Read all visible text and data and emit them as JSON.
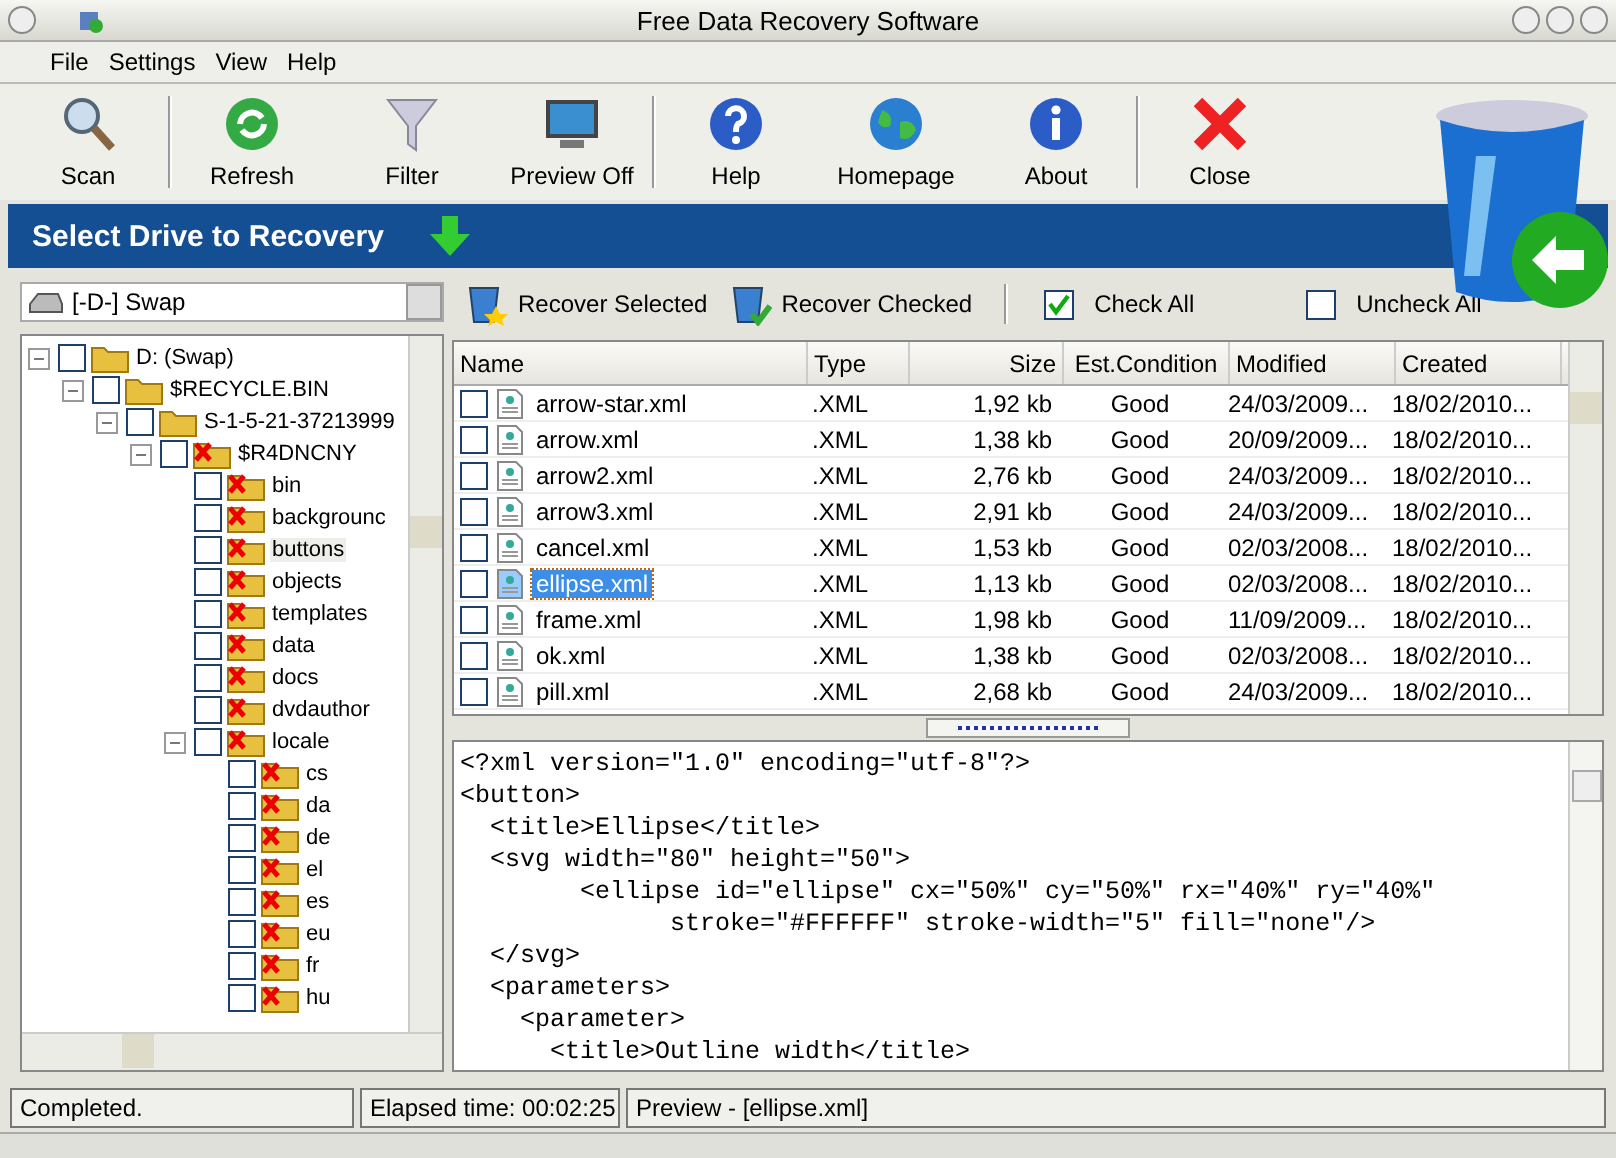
{
  "window": {
    "title": "Free Data Recovery Software"
  },
  "menu": [
    "File",
    "Settings",
    "View",
    "Help"
  ],
  "toolbar": [
    {
      "label": "Scan",
      "kind": "scan"
    },
    {
      "label": "Refresh",
      "kind": "refresh"
    },
    {
      "label": "Filter",
      "kind": "filter"
    },
    {
      "label": "Preview Off",
      "kind": "monitor"
    },
    {
      "label": "Help",
      "kind": "help"
    },
    {
      "label": "Homepage",
      "kind": "globe"
    },
    {
      "label": "About",
      "kind": "info"
    },
    {
      "label": "Close",
      "kind": "close"
    }
  ],
  "banner": {
    "title": "Select Drive to Recovery"
  },
  "drive": {
    "value": "[-D-] Swap"
  },
  "tree": [
    {
      "label": "D: (Swap)",
      "checked": false,
      "deleted": false,
      "selected": false,
      "children": [
        {
          "label": "$RECYCLE.BIN",
          "checked": false,
          "deleted": false,
          "selected": false,
          "children": [
            {
              "label": "S-1-5-21-37213999",
              "checked": false,
              "deleted": false,
              "selected": false,
              "children": [
                {
                  "label": "$R4DNCNY",
                  "checked": false,
                  "deleted": true,
                  "selected": false,
                  "children": [
                    {
                      "label": "bin",
                      "checked": false,
                      "deleted": true,
                      "selected": false
                    },
                    {
                      "label": "backgrounc",
                      "checked": false,
                      "deleted": true,
                      "selected": false
                    },
                    {
                      "label": "buttons",
                      "checked": false,
                      "deleted": true,
                      "selected": true
                    },
                    {
                      "label": "objects",
                      "checked": false,
                      "deleted": true,
                      "selected": false
                    },
                    {
                      "label": "templates",
                      "checked": false,
                      "deleted": true,
                      "selected": false
                    },
                    {
                      "label": "data",
                      "checked": false,
                      "deleted": true,
                      "selected": false
                    },
                    {
                      "label": "docs",
                      "checked": false,
                      "deleted": true,
                      "selected": false
                    },
                    {
                      "label": "dvdauthor",
                      "checked": false,
                      "deleted": true,
                      "selected": false
                    },
                    {
                      "label": "locale",
                      "checked": false,
                      "deleted": true,
                      "selected": false,
                      "children": [
                        {
                          "label": "cs",
                          "checked": false,
                          "deleted": true,
                          "selected": false
                        },
                        {
                          "label": "da",
                          "checked": false,
                          "deleted": true,
                          "selected": false
                        },
                        {
                          "label": "de",
                          "checked": false,
                          "deleted": true,
                          "selected": false
                        },
                        {
                          "label": "el",
                          "checked": false,
                          "deleted": true,
                          "selected": false
                        },
                        {
                          "label": "es",
                          "checked": false,
                          "deleted": true,
                          "selected": false
                        },
                        {
                          "label": "eu",
                          "checked": false,
                          "deleted": true,
                          "selected": false
                        },
                        {
                          "label": "fr",
                          "checked": false,
                          "deleted": true,
                          "selected": false
                        },
                        {
                          "label": "hu",
                          "checked": false,
                          "deleted": true,
                          "selected": false
                        }
                      ]
                    }
                  ]
                }
              ]
            }
          ]
        }
      ]
    }
  ],
  "actions": [
    {
      "label": "Recover Selected",
      "kind": "recover-selected"
    },
    {
      "label": "Recover Checked",
      "kind": "recover-checked"
    },
    {
      "label": "Check All",
      "kind": "checkbox",
      "checked": true
    },
    {
      "label": "Uncheck All",
      "kind": "checkbox",
      "checked": false
    }
  ],
  "table": {
    "columns": [
      "Name",
      "Type",
      "Size",
      "Est.Condition",
      "Modified",
      "Created"
    ],
    "rows": [
      {
        "name": "arrow-star.xml",
        "type": ".XML",
        "size": "1,92 kb",
        "condition": "Good",
        "modified": "24/03/2009...",
        "created": "18/02/2010...",
        "checked": false,
        "selected": false
      },
      {
        "name": "arrow.xml",
        "type": ".XML",
        "size": "1,38 kb",
        "condition": "Good",
        "modified": "20/09/2009...",
        "created": "18/02/2010...",
        "checked": false,
        "selected": false
      },
      {
        "name": "arrow2.xml",
        "type": ".XML",
        "size": "2,76 kb",
        "condition": "Good",
        "modified": "24/03/2009...",
        "created": "18/02/2010...",
        "checked": false,
        "selected": false
      },
      {
        "name": "arrow3.xml",
        "type": ".XML",
        "size": "2,91 kb",
        "condition": "Good",
        "modified": "24/03/2009...",
        "created": "18/02/2010...",
        "checked": false,
        "selected": false
      },
      {
        "name": "cancel.xml",
        "type": ".XML",
        "size": "1,53 kb",
        "condition": "Good",
        "modified": "02/03/2008...",
        "created": "18/02/2010...",
        "checked": false,
        "selected": false
      },
      {
        "name": "ellipse.xml",
        "type": ".XML",
        "size": "1,13 kb",
        "condition": "Good",
        "modified": "02/03/2008...",
        "created": "18/02/2010...",
        "checked": false,
        "selected": true
      },
      {
        "name": "frame.xml",
        "type": ".XML",
        "size": "1,98 kb",
        "condition": "Good",
        "modified": "11/09/2009...",
        "created": "18/02/2010...",
        "checked": false,
        "selected": false
      },
      {
        "name": "ok.xml",
        "type": ".XML",
        "size": "1,38 kb",
        "condition": "Good",
        "modified": "02/03/2008...",
        "created": "18/02/2010...",
        "checked": false,
        "selected": false
      },
      {
        "name": "pill.xml",
        "type": ".XML",
        "size": "2,68 kb",
        "condition": "Good",
        "modified": "24/03/2009...",
        "created": "18/02/2010...",
        "checked": false,
        "selected": false
      }
    ]
  },
  "preview": {
    "lines": [
      "<?xml version=\"1.0\" encoding=\"utf-8\"?>",
      "<button>",
      "  <title>Ellipse</title>",
      "  <svg width=\"80\" height=\"50\">",
      "        <ellipse id=\"ellipse\" cx=\"50%\" cy=\"50%\" rx=\"40%\" ry=\"40%\"",
      "              stroke=\"#FFFFFF\" stroke-width=\"5\" fill=\"none\"/>",
      "  </svg>",
      "  <parameters>",
      "    <parameter>",
      "      <title>Outline width</title>"
    ]
  },
  "status_bar": [
    "Completed.",
    "Elapsed time: 00:02:25",
    "Preview - [ellipse.xml]"
  ]
}
